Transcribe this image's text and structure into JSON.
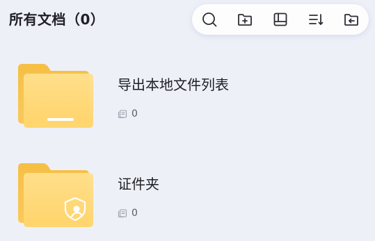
{
  "header": {
    "title": "所有文档（0）"
  },
  "toolbar": {
    "buttons": [
      {
        "icon": "search-icon"
      },
      {
        "icon": "new-folder-icon"
      },
      {
        "icon": "layout-icon"
      },
      {
        "icon": "sort-icon"
      },
      {
        "icon": "back-icon"
      }
    ]
  },
  "items": [
    {
      "name": "导出本地文件列表",
      "count": "0",
      "icon": "folder-export-icon"
    },
    {
      "name": "证件夹",
      "count": "0",
      "icon": "folder-id-icon"
    }
  ],
  "colors": {
    "background": "#eef0f8",
    "folder_back": "#f9c64f",
    "folder_front": "#ffd978",
    "icon_stroke": "#2b2d33"
  }
}
